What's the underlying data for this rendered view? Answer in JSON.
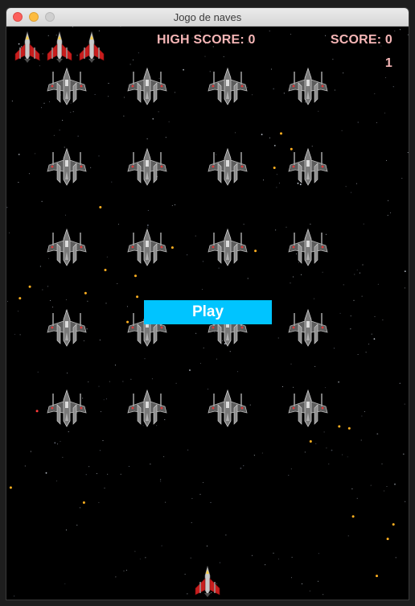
{
  "window": {
    "title": "Jogo de naves"
  },
  "hud": {
    "high_score_label": "HIGH SCORE: 0",
    "score_label": "SCORE: 0",
    "level": "1",
    "lives": 3
  },
  "play_button": {
    "label": "Play"
  },
  "colors": {
    "hud_text": "#f6b6b6",
    "play_button_bg": "#00c4ff",
    "background": "#000000"
  },
  "icons": {
    "life": "red-spaceship-icon",
    "enemy": "gray-spaceship-icon",
    "player": "player-spaceship-icon"
  },
  "enemy_fleet": {
    "rows": 5,
    "columns": 4
  }
}
